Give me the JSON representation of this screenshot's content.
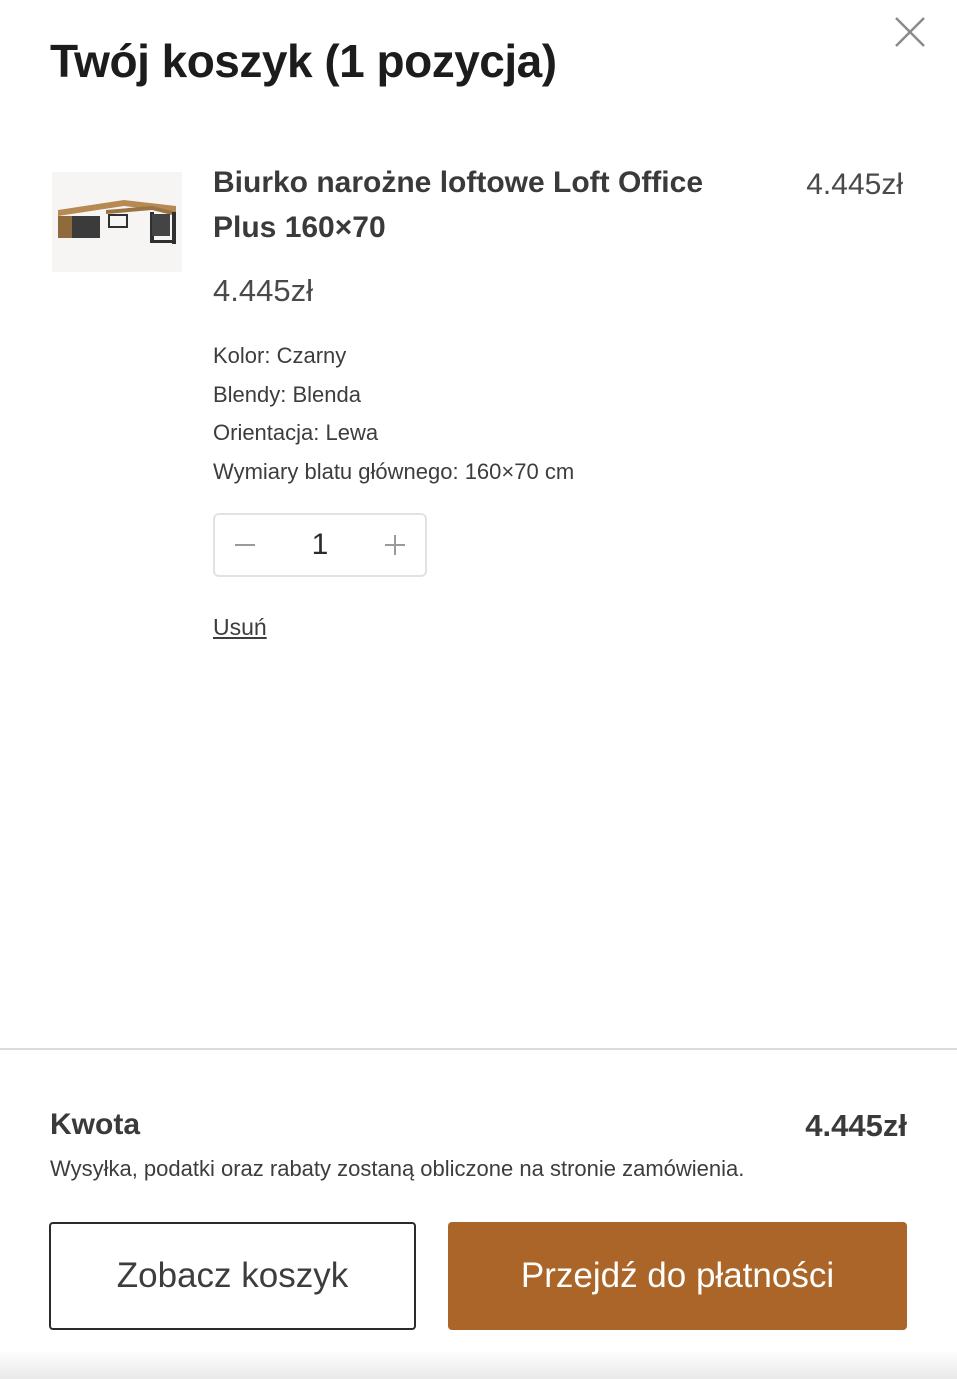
{
  "header": {
    "title": "Twój koszyk  (1 pozycja)",
    "close_icon": "close-icon"
  },
  "cart_item": {
    "name": "Biurko narożne loftowe Loft Office Plus 160×70",
    "line_total": "4.445zł",
    "price": "4.445zł",
    "properties": [
      "Kolor: Czarny",
      "Blendy: Blenda",
      "Orientacja: Lewa",
      "Wymiary blatu głównego: 160×70 cm"
    ],
    "quantity": "1",
    "remove_label": "Usuń",
    "image": "corner-desk-thumbnail"
  },
  "summary": {
    "label": "Kwota",
    "amount": "4.445zł",
    "note": "Wysyłka, podatki oraz rabaty zostaną obliczone na stronie zamówienia."
  },
  "actions": {
    "view_cart_label": "Zobacz koszyk",
    "checkout_label": "Przejdź do płatności"
  },
  "colors": {
    "accent": "#ab6528",
    "text": "#3a3a3a",
    "border": "#e2e2e2"
  }
}
